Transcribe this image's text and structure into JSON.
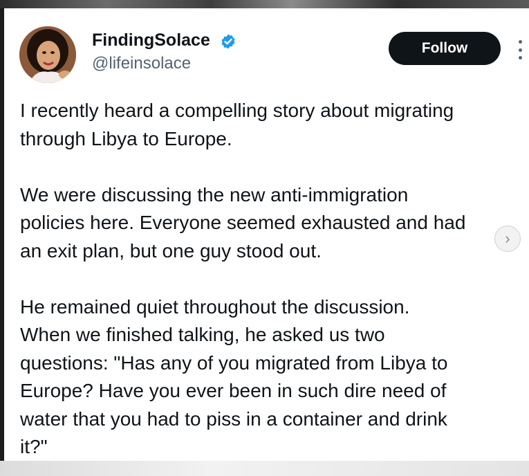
{
  "tweet": {
    "author": {
      "display_name": "FindingSolace",
      "handle": "@lifeinsolace",
      "verified": true
    },
    "follow_label": "Follow",
    "text_lines": [
      "I recently heard a compelling story about migrating",
      "through Libya to Europe.",
      "",
      "We were discussing the new anti-immigration",
      "policies here. Everyone seemed exhausted and had",
      "an exit plan, but one guy stood out.",
      "",
      "He remained quiet throughout the discussion.",
      "When we finished talking, he asked us two",
      "questions: \"Has any of you migrated from Libya to",
      "Europe? Have you ever been in such dire need of",
      "water that you had to piss in a container and drink",
      "it?\""
    ]
  },
  "icons": {
    "verified": "verified-badge-icon",
    "more": "more-options-icon",
    "next": "chevron-right-icon"
  },
  "colors": {
    "verified_blue": "#1d9bf0",
    "follow_bg": "#0f1419",
    "text": "#0f1419",
    "muted": "#536471"
  }
}
